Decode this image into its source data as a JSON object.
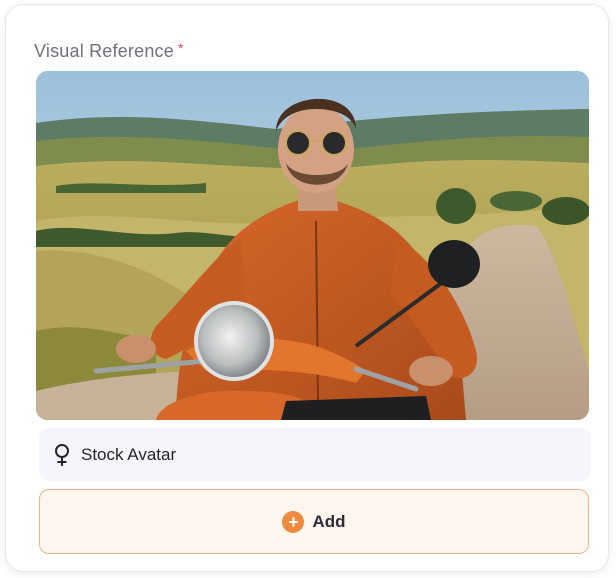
{
  "field": {
    "label": "Visual Reference",
    "required_mark": "*"
  },
  "image": {
    "alt": "Man in orange leather jacket and sunglasses riding an orange scooter on a country road through rolling hills"
  },
  "avatar": {
    "icon": "female-symbol-icon",
    "label": "Stock Avatar"
  },
  "add_button": {
    "icon": "plus-circle-icon",
    "label": "Add"
  },
  "colors": {
    "accent": "#f08a3e",
    "accent_border": "#f1b385",
    "accent_bg": "#fff6ef",
    "required": "#e5484d",
    "row_bg": "#f4f6fb"
  }
}
